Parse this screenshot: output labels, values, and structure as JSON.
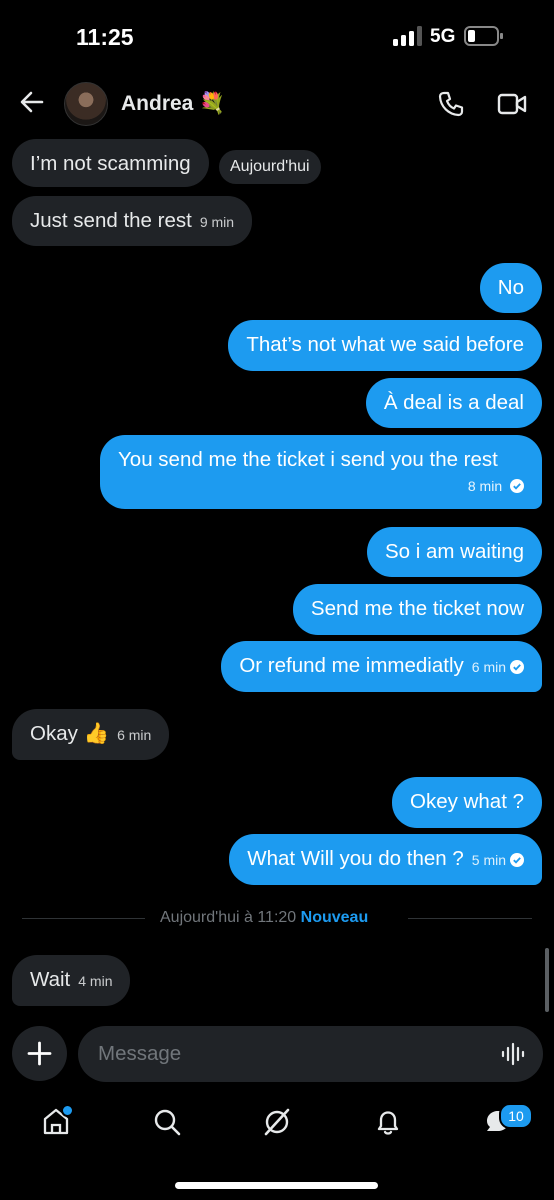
{
  "status": {
    "time": "11:25",
    "network": "5G"
  },
  "header": {
    "name": "Andrea 💐"
  },
  "day_pill": "Aujourd'hui",
  "messages": [
    {
      "dir": "in",
      "text": "I’m not scamming",
      "time": ""
    },
    {
      "dir": "in",
      "text": "Just send the rest",
      "time": "9 min"
    },
    {
      "dir": "out",
      "text": "No",
      "time": ""
    },
    {
      "dir": "out",
      "text": "That’s not what we said before",
      "time": ""
    },
    {
      "dir": "out",
      "text": "À deal is a deal",
      "time": ""
    },
    {
      "dir": "out",
      "text": "You send me the ticket i send you the rest",
      "time": "8 min"
    },
    {
      "dir": "out",
      "text": "So i am waiting",
      "time": ""
    },
    {
      "dir": "out",
      "text": "Send me the ticket now",
      "time": ""
    },
    {
      "dir": "out",
      "text": "Or refund me immediatly",
      "time": "6 min"
    },
    {
      "dir": "in",
      "text": "Okay 👍",
      "time": "6 min"
    },
    {
      "dir": "out",
      "text": "Okey what ?",
      "time": ""
    },
    {
      "dir": "out",
      "text": "What Will you do then ?",
      "time": "5 min"
    },
    {
      "dir": "in",
      "text": "Wait",
      "time": "4 min"
    }
  ],
  "divider": {
    "text": "Aujourd'hui à 11:20",
    "new_label": "Nouveau"
  },
  "composer": {
    "placeholder": "Message"
  },
  "tabbar": {
    "messages_badge": "10"
  },
  "colors": {
    "accent": "#1d9bf0",
    "incoming_bubble": "#202327",
    "background": "#000000"
  },
  "icons": [
    "back-arrow-icon",
    "phone-icon",
    "video-icon",
    "plus-icon",
    "voice-icon",
    "home-icon",
    "search-icon",
    "grok-icon",
    "bell-icon",
    "messages-icon"
  ]
}
